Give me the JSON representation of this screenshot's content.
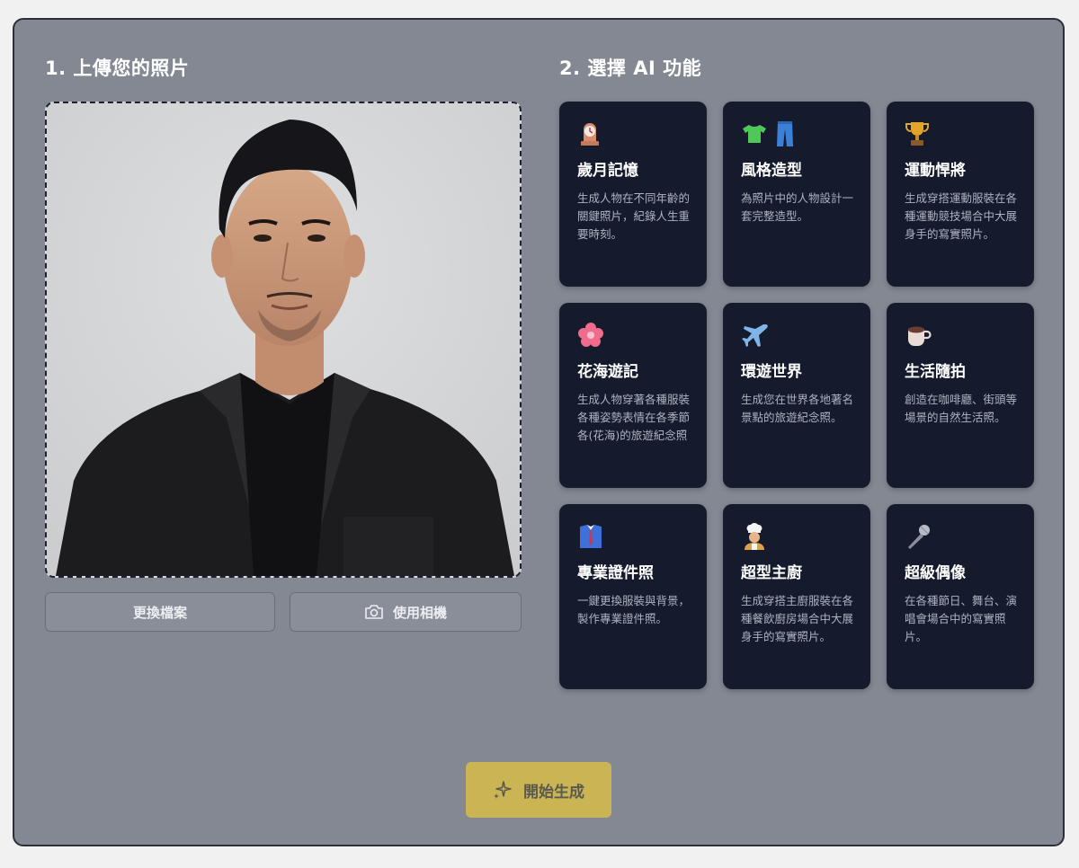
{
  "upload_section": {
    "title": "1. 上傳您的照片",
    "change_file_label": "更換檔案",
    "use_camera_label": "使用相機"
  },
  "features_section": {
    "title": "2. 選擇 AI 功能",
    "cards": [
      {
        "icon": "clock-icon",
        "title": "歲月記憶",
        "desc": "生成人物在不同年齡的關鍵照片，紀錄人生重要時刻。"
      },
      {
        "icon": "tshirt-jeans-icon",
        "title": "風格造型",
        "desc": "為照片中的人物設計一套完整造型。"
      },
      {
        "icon": "trophy-icon",
        "title": "運動悍將",
        "desc": "生成穿搭運動服裝在各種運動競技場合中大展身手的寫實照片。"
      },
      {
        "icon": "flower-icon",
        "title": "花海遊記",
        "desc": "生成人物穿著各種服裝各種姿勢表情在各季節各(花海)的旅遊紀念照"
      },
      {
        "icon": "airplane-icon",
        "title": "環遊世界",
        "desc": "生成您在世界各地著名景點的旅遊紀念照。"
      },
      {
        "icon": "coffee-icon",
        "title": "生活隨拍",
        "desc": "創造在咖啡廳、街頭等場景的自然生活照。"
      },
      {
        "icon": "suit-icon",
        "title": "專業證件照",
        "desc": "一鍵更換服裝與背景，製作專業證件照。"
      },
      {
        "icon": "chef-icon",
        "title": "超型主廚",
        "desc": "生成穿搭主廚服裝在各種餐飲廚房場合中大展身手的寫實照片。"
      },
      {
        "icon": "microphone-icon",
        "title": "超級偶像",
        "desc": "在各種節日、舞台、演唱會場合中的寫實照片。"
      }
    ]
  },
  "generate_button": {
    "label": "開始生成",
    "icon": "sparkle-icon"
  },
  "colors": {
    "panel_bg": "#848892",
    "card_bg": "#151a2c",
    "accent": "#cbb453"
  }
}
